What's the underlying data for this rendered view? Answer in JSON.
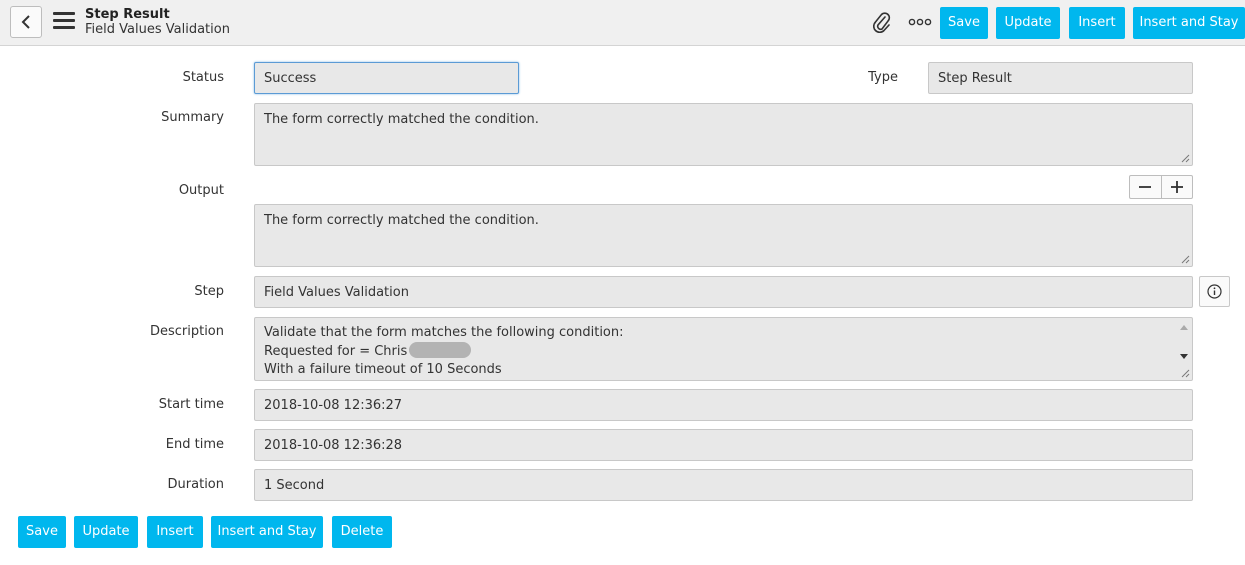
{
  "header": {
    "title": "Step Result",
    "subtitle": "Field Values Validation",
    "buttons": {
      "save": "Save",
      "update": "Update",
      "insert": "Insert",
      "insert_and_stay": "Insert and Stay"
    }
  },
  "form": {
    "status": {
      "label": "Status",
      "value": "Success"
    },
    "type": {
      "label": "Type",
      "value": "Step Result"
    },
    "summary": {
      "label": "Summary",
      "value": "The form correctly matched the condition."
    },
    "output": {
      "label": "Output",
      "value": "The form correctly matched the condition."
    },
    "step": {
      "label": "Step",
      "value": "Field Values Validation"
    },
    "description": {
      "label": "Description",
      "line1": "Validate that the form matches the following condition:",
      "line2": "Requested for = Chris",
      "line3": "With a failure timeout of 10 Seconds"
    },
    "start_time": {
      "label": "Start time",
      "value": "2018-10-08 12:36:27"
    },
    "end_time": {
      "label": "End time",
      "value": "2018-10-08 12:36:28"
    },
    "duration": {
      "label": "Duration",
      "value": "1 Second"
    }
  },
  "footer": {
    "buttons": {
      "save": "Save",
      "update": "Update",
      "insert": "Insert",
      "insert_and_stay": "Insert and Stay",
      "delete": "Delete"
    }
  },
  "colors": {
    "accent": "#00b7ee",
    "header_bg": "#f0f0f0",
    "field_bg": "#e8e8e8",
    "focus_border": "#5b9bd5"
  },
  "icons": {
    "back": "chevron-left-icon",
    "menu": "hamburger-icon",
    "attachment": "paperclip-icon",
    "more": "more-options-icon",
    "minus": "minus-icon",
    "plus": "plus-icon",
    "info": "info-icon"
  }
}
